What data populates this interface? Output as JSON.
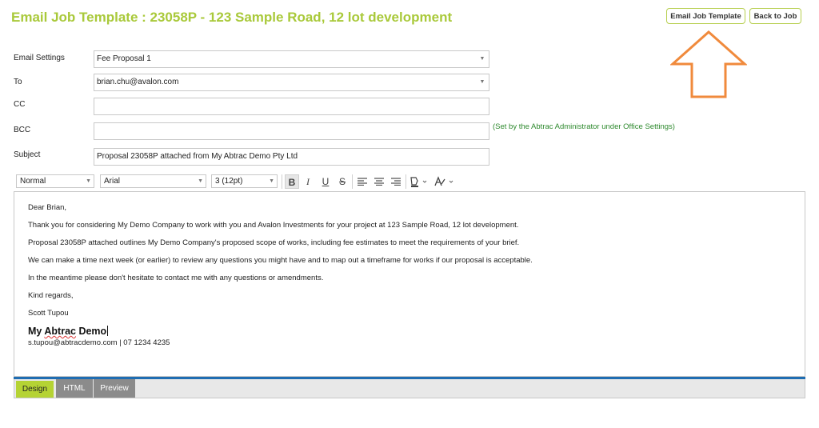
{
  "page": {
    "title": "Email Job Template : 23058P - 123 Sample Road, 12 lot development"
  },
  "header_buttons": {
    "email_job_template": "Email Job Template",
    "back_to_job": "Back to Job"
  },
  "colors": {
    "accent_green": "#a9c93a",
    "annotation_arrow": "#f08a3c",
    "note_green": "#2f8a2f",
    "active_tab": "#b5d334",
    "editor_bar": "#1f6db2"
  },
  "form": {
    "email_settings": {
      "label": "Email Settings",
      "value": "Fee Proposal 1"
    },
    "to": {
      "label": "To",
      "value": "brian.chu@avalon.com"
    },
    "cc": {
      "label": "CC",
      "value": ""
    },
    "bcc": {
      "label": "BCC",
      "value": "",
      "note": "(Set by the Abtrac Administrator under Office Settings)"
    },
    "subject": {
      "label": "Subject",
      "value": "Proposal 23058P attached from My Abtrac Demo Pty Ltd"
    }
  },
  "toolbar": {
    "format": "Normal",
    "font": "Arial",
    "size": "3 (12pt)",
    "bold": "B",
    "italic": "I",
    "underline": "U",
    "strike": "S"
  },
  "body": {
    "greeting": "Dear Brian,",
    "p1": "Thank you for considering My Demo Company to work with you and Avalon Investments for your project at 123 Sample Road, 12 lot development.",
    "p2": "Proposal 23058P attached outlines My Demo Company's proposed scope of works, including fee estimates to meet the requirements of your brief.",
    "p3": "We can make a time next week (or earlier) to review any questions you might have and to map out a timeframe for works if our proposal is acceptable.",
    "p4": "In the meantime please don't hesitate to contact me with any questions or amendments.",
    "closing": "Kind regards,",
    "sender": "Scott Tupou",
    "company_prefix": "My ",
    "company_word": "Abtrac",
    "company_suffix": " Demo",
    "contact": "s.tupou@abtracdemo.com | 07 1234 4235"
  },
  "tabs": {
    "design": "Design",
    "html": "HTML",
    "preview": "Preview"
  }
}
